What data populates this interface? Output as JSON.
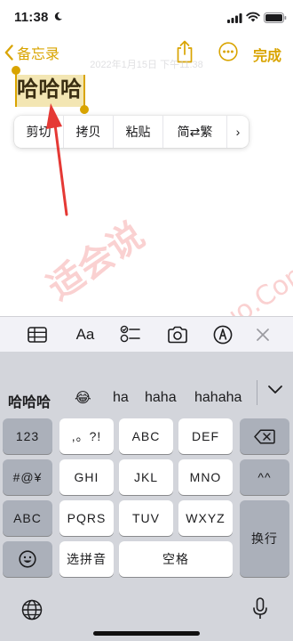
{
  "status": {
    "time": "11:38"
  },
  "nav": {
    "back_label": "备忘录",
    "done_label": "完成"
  },
  "note": {
    "date": "2022年1月15日 下午11:38",
    "text": "哈哈哈"
  },
  "edit_menu": {
    "items": [
      "剪切",
      "拷贝",
      "粘贴",
      "简⇄繁",
      "›"
    ]
  },
  "watermark": {
    "text_cn": "适会说",
    "text_en": "www.ShiHuiShuo.Com"
  },
  "format_bar": {
    "text_style_label": "Aa"
  },
  "keyboard": {
    "candidates": [
      "哈哈哈",
      "😂",
      "ha",
      "haha",
      "hahaha"
    ],
    "row1": [
      "123",
      ",。?!",
      "ABC",
      "DEF"
    ],
    "row2": [
      "#@¥",
      "GHI",
      "JKL",
      "MNO",
      "^^"
    ],
    "row3": [
      "ABC",
      "PQRS",
      "TUV",
      "WXYZ",
      "换行"
    ],
    "row4": [
      "选拼音",
      "空格"
    ]
  },
  "colors": {
    "accent": "#d9a400",
    "selection": "#f3e6b3",
    "keyboard_bg": "#d3d5db",
    "arrow": "#e53935"
  }
}
